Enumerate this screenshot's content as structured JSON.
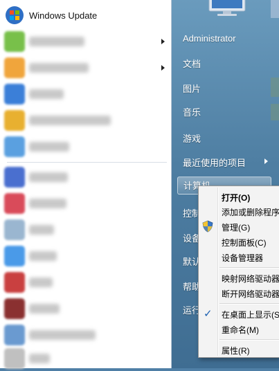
{
  "left_programs": [
    {
      "label": "Windows Update",
      "has_submenu": false,
      "icon": "windows-update-icon",
      "color": "#2f6fc4"
    },
    {
      "label": "",
      "has_submenu": true,
      "icon": "program-icon",
      "color": "#78c04a"
    },
    {
      "label": "",
      "has_submenu": true,
      "icon": "program-icon",
      "color": "#f0a53c"
    },
    {
      "label": "",
      "has_submenu": false,
      "icon": "program-icon",
      "color": "#3b7fd8"
    },
    {
      "label": "",
      "has_submenu": false,
      "icon": "program-icon",
      "color": "#e8b030"
    },
    {
      "label": "",
      "has_submenu": false,
      "icon": "program-icon",
      "color": "#5aa0e0"
    },
    {
      "label": "",
      "has_submenu": false,
      "icon": "program-icon",
      "color": "#4a6fcf"
    },
    {
      "label": "",
      "has_submenu": false,
      "icon": "program-icon",
      "color": "#d94b5a"
    },
    {
      "label": "",
      "has_submenu": false,
      "icon": "program-icon",
      "color": "#9ab6d0"
    },
    {
      "label": "",
      "has_submenu": false,
      "icon": "program-icon",
      "color": "#4a9ae8"
    },
    {
      "label": "",
      "has_submenu": false,
      "icon": "program-icon",
      "color": "#c94040"
    },
    {
      "label": "",
      "has_submenu": false,
      "icon": "program-icon",
      "color": "#8a3030"
    },
    {
      "label": "",
      "has_submenu": false,
      "icon": "program-icon",
      "color": "#6a9ad0"
    },
    {
      "label": "",
      "has_submenu": false,
      "icon": "program-icon",
      "color": "#c0c0c0"
    }
  ],
  "right_items": {
    "user": "Administrator",
    "documents": "文档",
    "pictures": "图片",
    "music": "音乐",
    "games": "游戏",
    "recent": "最近使用的项目",
    "computer": "计算机",
    "control_panel": "控制",
    "devices": "设备",
    "default_programs": "默认",
    "help": "帮助",
    "run": "运行"
  },
  "context_menu": {
    "open": "打开(O)",
    "add_remove": "添加或删除程序",
    "manage": "管理(G)",
    "control_panel": "控制面板(C)",
    "device_manager": "设备管理器",
    "map_drive": "映射网络驱动器",
    "disconnect_drive": "断开网络驱动器",
    "show_desktop": "在桌面上显示(S",
    "rename": "重命名(M)",
    "properties": "属性(R)"
  },
  "colors": {
    "right_pane": "#4e7ea2",
    "menu_bg": "#f3f3f3",
    "check": "#1b5fb0"
  }
}
